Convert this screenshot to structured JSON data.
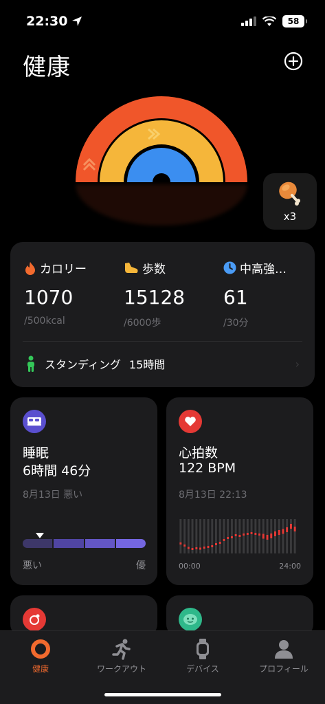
{
  "status_bar": {
    "time": "22:30",
    "battery": "58"
  },
  "header": {
    "title": "健康"
  },
  "reward": {
    "count": "x3"
  },
  "activity": {
    "calories": {
      "label": "カロリー",
      "value": "1070",
      "goal": "/500kcal"
    },
    "steps": {
      "label": "歩数",
      "value": "15128",
      "goal": "/6000歩"
    },
    "intensity": {
      "label": "中高強…",
      "value": "61",
      "goal": "/30分"
    },
    "standing": {
      "label": "スタンディング",
      "value": "15時間"
    }
  },
  "sleep": {
    "title": "睡眠",
    "value": "6時間 46分",
    "date": "8月13日 悪い",
    "axis_left": "悪い",
    "axis_right": "優",
    "level_fraction": 0.14
  },
  "heart_rate": {
    "title": "心拍数",
    "value": "122 BPM",
    "date": "8月13日 22:13",
    "axis_start": "00:00",
    "axis_end": "24:00"
  },
  "tabs": [
    {
      "label": "健康",
      "icon": "ring-icon",
      "active": true
    },
    {
      "label": "ワークアウト",
      "icon": "running-icon",
      "active": false
    },
    {
      "label": "デバイス",
      "icon": "watch-icon",
      "active": false
    },
    {
      "label": "プロフィール",
      "icon": "profile-icon",
      "active": false
    }
  ],
  "colors": {
    "accent": "#f26a2e",
    "rainbow_outer": "#f0562a",
    "rainbow_middle": "#f5b63a",
    "rainbow_inner": "#3b8ef0",
    "sleep_purple": "#5a4fcf",
    "heart_red": "#e53935",
    "standing_green": "#34c759"
  }
}
